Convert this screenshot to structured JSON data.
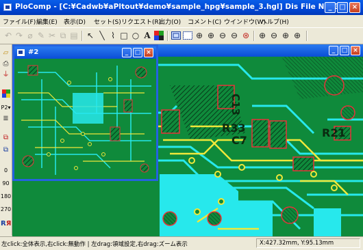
{
  "app": {
    "title": "PloComp - [C:¥Cadwb¥aPltout¥demo¥sample_hpg¥sample_3.hgl] Dis File No. 3 4 5"
  },
  "menu": [
    "ファイル(F)",
    "編集(E)",
    "表示(D)",
    "セット(S)",
    "リクエスト(R)",
    "出力(O)",
    "コメント(C)",
    "ウインドウ(W)",
    "ヘルプ(H)"
  ],
  "toolbar": {
    "icons": [
      "undo-icon",
      "redo-icon",
      "eraser-icon",
      "pen-icon",
      "cut-icon",
      "copy-icon",
      "paste-icon",
      "pointer-icon",
      "line-icon",
      "arc-icon",
      "rectangle-icon",
      "circle-icon",
      "text-icon",
      "color-icon",
      "fit-window-icon",
      "zoom-region-icon",
      "zoom-center-icon",
      "zoom-in-icon",
      "zoom-out-icon",
      "zoom-prev-icon",
      "zoom-custom-icon",
      "zoom-a-icon",
      "zoom-b-icon",
      "zoom-c-icon",
      "zoom-d-icon"
    ]
  },
  "left_toolbar": {
    "page_label": "P2",
    "rotations": [
      "0",
      "90",
      "180",
      "270"
    ]
  },
  "child_window": {
    "title": "#2"
  },
  "pcb_labels": {
    "c13": "C13",
    "r33": "R33",
    "c7": "C7",
    "r21": "R21"
  },
  "status": {
    "hint": "左click:全体表示,右click:無動作 | 左drag:領域設定,右drag:ズーム表示",
    "coords": "X:427.32mm, Y:95.13mm"
  },
  "colors": {
    "board_green": "#0f8a3b",
    "trace_cyan": "#27e8ec",
    "trace_yellow": "#f0e83a",
    "pad_red": "#e8323a",
    "titlebar_blue": "#0a5ee8"
  }
}
